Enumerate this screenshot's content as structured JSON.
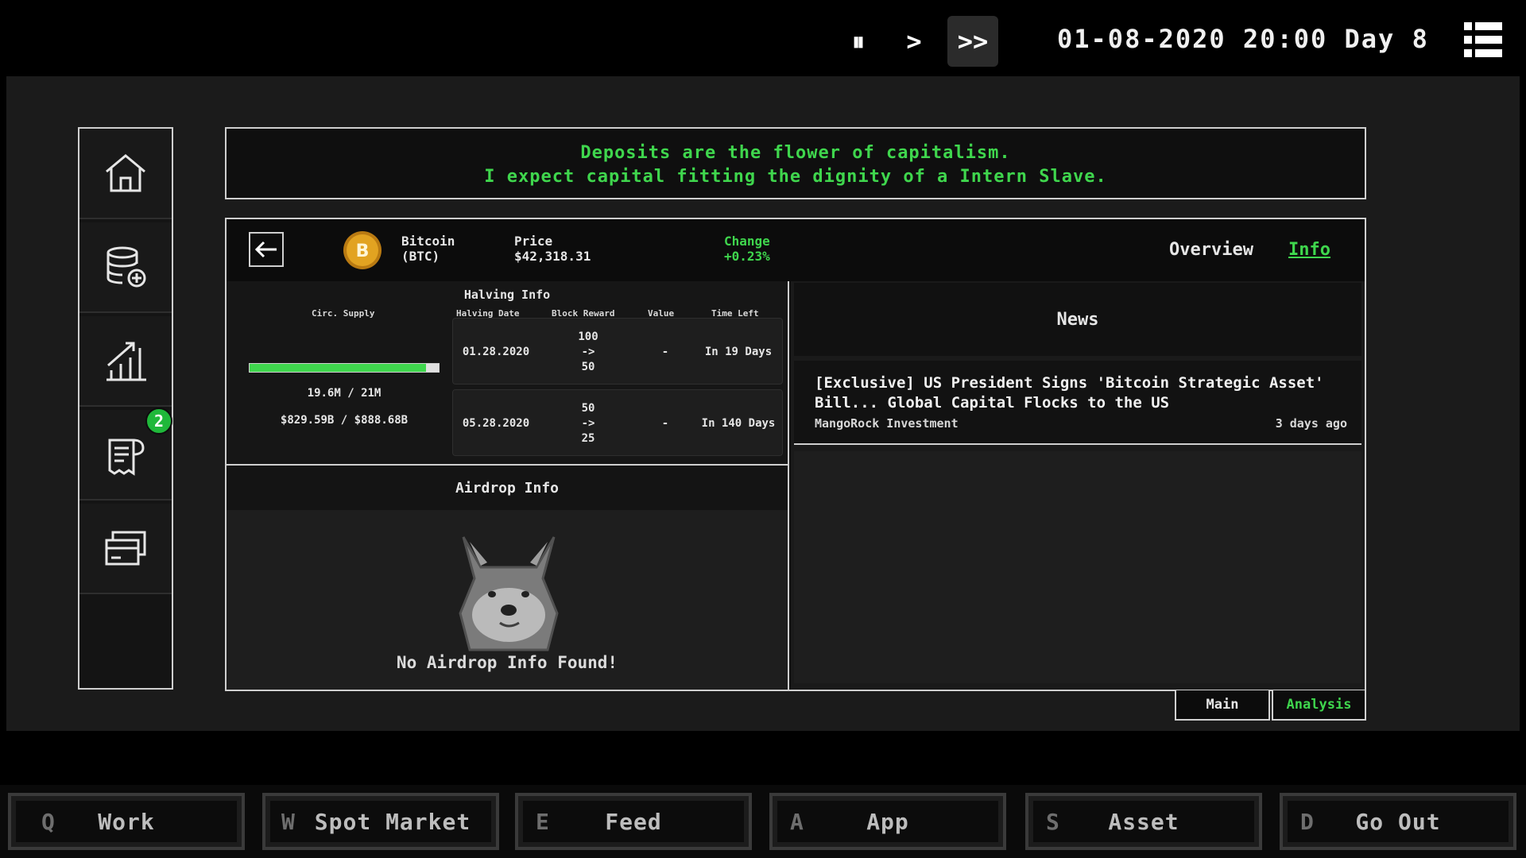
{
  "topbar": {
    "pause_label": "⏸",
    "play_label": ">",
    "fast_label": ">>",
    "datetime": "01-08-2020 20:00 Day 8"
  },
  "sidebar": {
    "items": [
      {
        "icon": "home-icon"
      },
      {
        "icon": "database-add-icon"
      },
      {
        "icon": "growth-chart-icon"
      },
      {
        "icon": "receipt-icon"
      },
      {
        "icon": "cards-icon"
      }
    ],
    "badge_count": "2"
  },
  "quote": {
    "line1": "Deposits are the flower of capitalism.",
    "line2": "I expect capital fitting the dignity of a Intern Slave."
  },
  "coin": {
    "name": "Bitcoin",
    "ticker": "(BTC)",
    "price_label": "Price",
    "price_value": "$42,318.31",
    "change_label": "Change",
    "change_value": "+0.23%",
    "tab_overview": "Overview",
    "tab_info": "Info"
  },
  "halving": {
    "title": "Halving Info",
    "headers": {
      "circ_supply": "Circ. Supply",
      "halving_date": "Halving Date",
      "block_reward": "Block Reward",
      "value": "Value",
      "time_left": "Time Left"
    },
    "supply_fraction": 0.933,
    "supply_text": "19.6M / 21M",
    "cap_text": "$829.59B / $888.68B",
    "rows": [
      {
        "date": "01.28.2020",
        "reward_from": "100",
        "arrow": "->",
        "reward_to": "50",
        "value": "-",
        "time_left": "In 19 Days"
      },
      {
        "date": "05.28.2020",
        "reward_from": "50",
        "arrow": "->",
        "reward_to": "25",
        "value": "-",
        "time_left": "In 140 Days"
      }
    ]
  },
  "airdrop": {
    "title": "Airdrop Info",
    "empty_text": "No Airdrop Info Found!"
  },
  "news": {
    "title": "News",
    "items": [
      {
        "headline": "[Exclusive] US President Signs 'Bitcoin Strategic Asset' Bill... Global Capital Flocks to the US",
        "source": "MangoRock Investment",
        "time": "3 days ago"
      }
    ]
  },
  "bottom_tabs": {
    "main": "Main",
    "analysis": "Analysis"
  },
  "hotkeys": [
    {
      "key": "Q",
      "label": "Work"
    },
    {
      "key": "W",
      "label": "Spot Market"
    },
    {
      "key": "E",
      "label": "Feed"
    },
    {
      "key": "A",
      "label": "App"
    },
    {
      "key": "S",
      "label": "Asset"
    },
    {
      "key": "D",
      "label": "Go Out"
    }
  ],
  "colors": {
    "accent_green": "#3fd64d",
    "badge_green": "#1fb83a",
    "border": "#cfcfcf",
    "coin_gold": "#e2a321"
  }
}
